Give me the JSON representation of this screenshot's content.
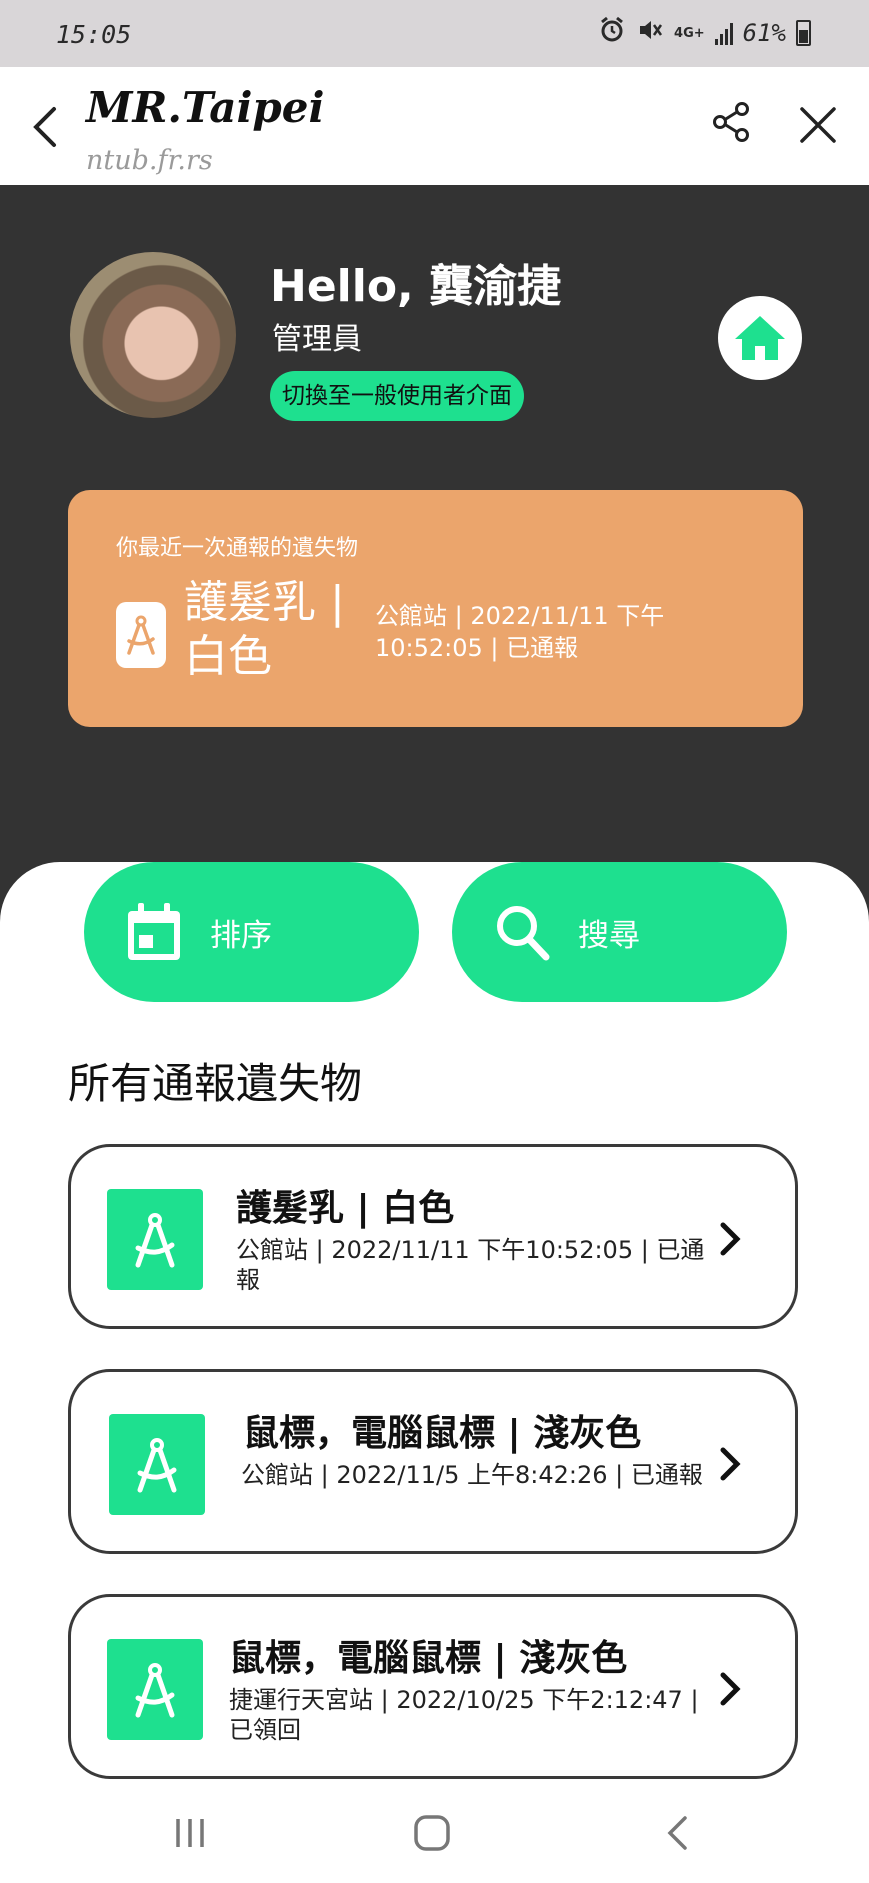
{
  "status_bar": {
    "time": "15:05",
    "network": "4G+",
    "battery": "61%"
  },
  "header": {
    "title": "MR.Taipei",
    "domain": "ntub.fr.rs",
    "back_icon": "back-arrow-icon",
    "share_icon": "share-icon",
    "close_icon": "close-icon"
  },
  "profile": {
    "greeting": "Hello, 龔渝捷",
    "role": "管理員",
    "switch_label": "切換至一般使用者介面",
    "home_icon": "home-icon"
  },
  "latest": {
    "caption": "你最近一次通報的遺失物",
    "name": "護髮乳 | 白色",
    "meta": "公館站 | 2022/11/11 下午10:52:05 | 已通報",
    "icon": "compass-icon"
  },
  "actions": {
    "sort_label": "排序",
    "sort_icon": "calendar-icon",
    "search_label": "搜尋",
    "search_icon": "search-icon"
  },
  "section_title": "所有通報遺失物",
  "items": [
    {
      "name": "護髮乳 | 白色",
      "meta": "公館站 | 2022/11/11 下午10:52:05 | 已通報"
    },
    {
      "name": "鼠標，電腦鼠標 | 淺灰色",
      "meta": "公館站 | 2022/11/5 上午8:42:26 | 已通報"
    },
    {
      "name": "鼠標，電腦鼠標 | 淺灰色",
      "meta": "捷運行天宮站 | 2022/10/25 下午2:12:47 | 已領回"
    }
  ],
  "colors": {
    "accent": "#1ee08f",
    "card_orange": "#eba56c",
    "dark_bg": "#333333"
  }
}
